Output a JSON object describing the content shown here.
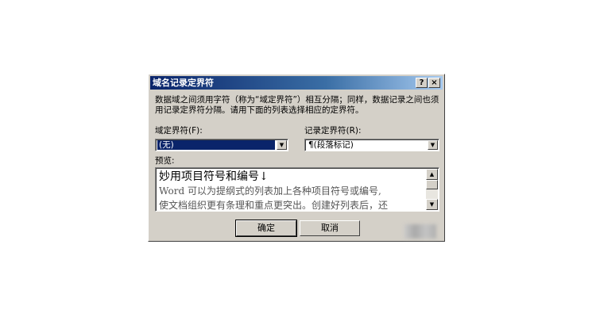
{
  "dialog": {
    "title": "域名记录定界符",
    "help_button": "?",
    "close_button": "×"
  },
  "description": "数据域之间须用字符（称为“域定界符”）相互分隔；同样，数据记录之间也须用记录定界符分隔。请用下面的列表选择相应的定界符。",
  "field_delimiter": {
    "label": "域定界符(F):",
    "value": "(无)"
  },
  "record_delimiter": {
    "label": "记录定界符(R):",
    "value": "¶(段落标记)"
  },
  "preview": {
    "label": "预览:",
    "title": "妙用项目符号和编号↓",
    "lines": [
      "Word 可以为提纲式的列表加上各种项目符号或编号,",
      "使文档组织更有条理和重点更突出。创建好列表后，还"
    ]
  },
  "buttons": {
    "ok": "确定",
    "cancel": "取消"
  },
  "icons": {
    "dropdown": "chevron-down-icon",
    "scroll_up": "arrow-up-icon",
    "scroll_down": "arrow-down-icon"
  }
}
